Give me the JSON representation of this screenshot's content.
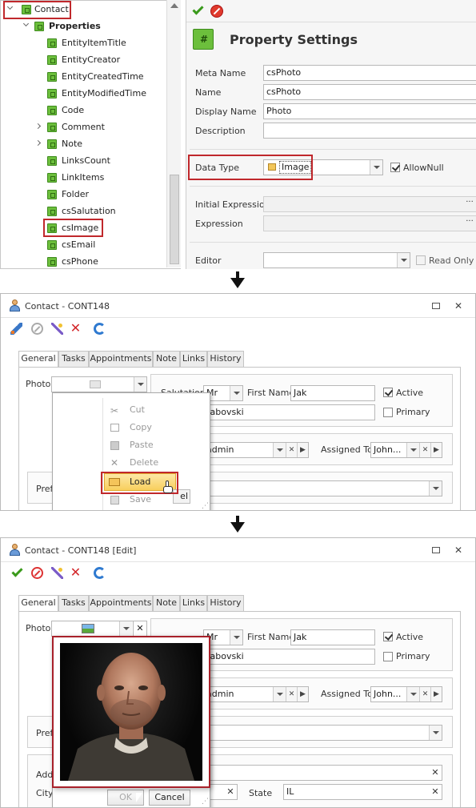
{
  "tree": {
    "root": "Contact",
    "properties": "Properties",
    "items": [
      "EntityItemTitle",
      "EntityCreator",
      "EntityCreatedTime",
      "EntityModifiedTime",
      "Code",
      "Comment",
      "Note",
      "LinksCount",
      "LinkItems",
      "Folder",
      "csSalutation",
      "csImage",
      "csEmail",
      "csPhone"
    ]
  },
  "property_settings": {
    "title": "Property Settings",
    "meta_name_label": "Meta Name",
    "meta_name_value": "csPhoto",
    "name_label": "Name",
    "name_value": "csPhoto",
    "display_name_label": "Display Name",
    "display_name_value": "Photo",
    "description_label": "Description",
    "data_type_label": "Data Type",
    "data_type_value": "Image",
    "allow_null_label": "AllowNull",
    "initial_expression_label": "Initial Expression",
    "expression_label": "Expression",
    "editor_label": "Editor",
    "read_only_label": "Read Only"
  },
  "win2": {
    "title": "Contact - CONT148",
    "tabs": [
      "General",
      "Tasks",
      "Appointments",
      "Note",
      "Links",
      "History"
    ],
    "photo_label": "Photo",
    "salutation_label": "Salutation",
    "salutation_value": "Mr",
    "first_name_label": "First Name",
    "first_name_value": "Jak",
    "active_label": "Active",
    "last_name_value": "rabovski",
    "primary_label": "Primary",
    "owner_value": "admin",
    "assigned_to_label": "Assigned To",
    "assigned_to_value": "John...",
    "pref_label": "Pref",
    "context_menu": [
      "Cut",
      "Copy",
      "Paste",
      "Delete",
      "Load",
      "Save"
    ],
    "hint": "el"
  },
  "win3": {
    "title": "Contact - CONT148 [Edit]",
    "tabs": [
      "General",
      "Tasks",
      "Appointments",
      "Note",
      "Links",
      "History"
    ],
    "photo_label": "Photo",
    "salutation_value": "Mr",
    "first_name_label": "First Name",
    "first_name_value": "Jak",
    "active_label": "Active",
    "last_name_value": "rabovski",
    "primary_label": "Primary",
    "owner_value": "admin",
    "assigned_to_label": "Assigned To",
    "assigned_to_value": "John...",
    "pref_label": "Pref",
    "address_label": "Add",
    "city_label": "City",
    "state_label": "State",
    "state_value": "IL",
    "ok_label": "OK",
    "cancel_label": "Cancel"
  },
  "colors": {
    "highlight_red": "#c0282c",
    "accent_green": "#6cbf3c"
  }
}
